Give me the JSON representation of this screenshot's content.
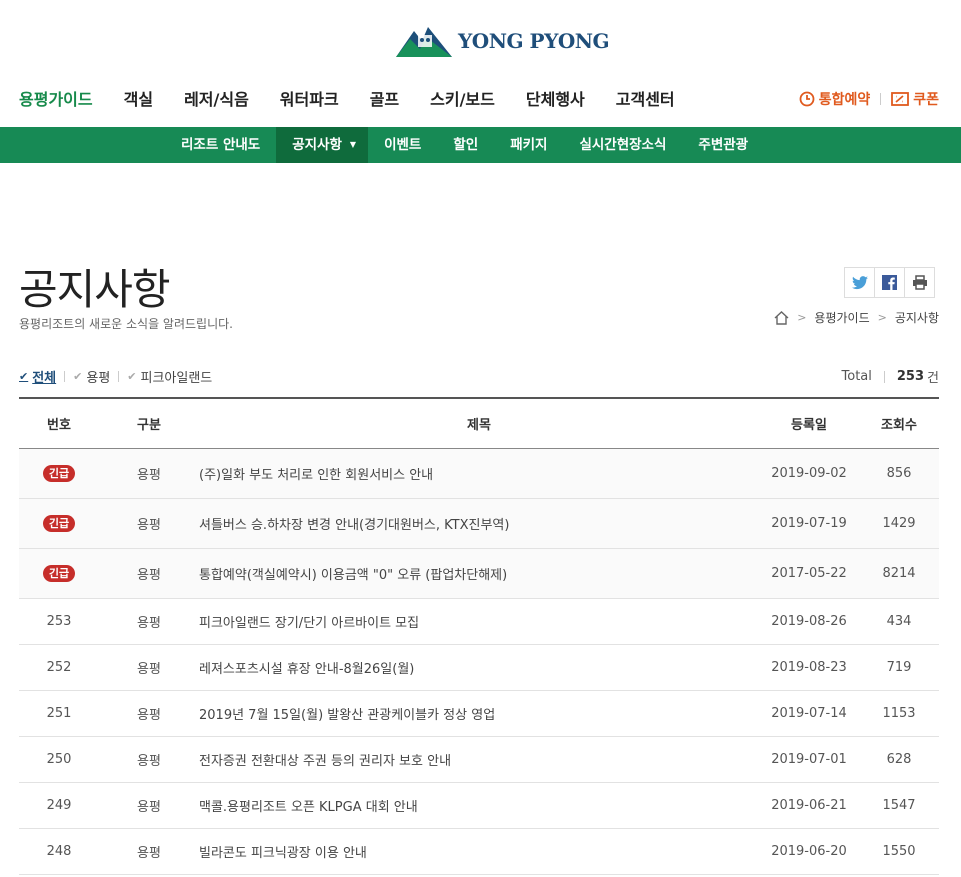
{
  "header": {
    "logo_text": "YONG PYONG",
    "main_nav": [
      "용평가이드",
      "객실",
      "레저/식음",
      "워터파크",
      "골프",
      "스키/보드",
      "단체행사",
      "고객센터"
    ],
    "active_index": 0,
    "util": {
      "reserve": "통합예약",
      "coupon": "쿠폰"
    }
  },
  "sub_nav": {
    "items": [
      "리조트 안내도",
      "공지사항",
      "이벤트",
      "할인",
      "패키지",
      "실시간현장소식",
      "주변관광"
    ],
    "active_index": 1
  },
  "page": {
    "title": "공지사항",
    "description": "용평리조트의 새로운 소식을 알려드립니다.",
    "breadcrumb": [
      "용평가이드",
      "공지사항"
    ]
  },
  "colors": {
    "brand_green": "#178a55",
    "active_green": "#178a4b",
    "urgent_red": "#c62e2a",
    "util_orange": "#e05a1e",
    "navy": "#1f4e7a"
  },
  "filters": {
    "items": [
      "전체",
      "용평",
      "피크아일랜드"
    ],
    "active_index": 0,
    "total_label": "Total",
    "total_count": "253",
    "total_unit": "건"
  },
  "table": {
    "headers": {
      "no": "번호",
      "category": "구분",
      "title": "제목",
      "date": "등록일",
      "views": "조회수"
    },
    "urgent_label": "긴급",
    "rows": [
      {
        "urgent": true,
        "no": "",
        "category": "용평",
        "title": "(주)일화 부도 처리로 인한 회원서비스 안내",
        "date": "2019-09-02",
        "views": "856"
      },
      {
        "urgent": true,
        "no": "",
        "category": "용평",
        "title": "셔틀버스 승.하차장 변경 안내(경기대원버스, KTX진부역)",
        "date": "2019-07-19",
        "views": "1429"
      },
      {
        "urgent": true,
        "no": "",
        "category": "용평",
        "title": "통합예약(객실예약시) 이용금액 \"0\" 오류 (팝업차단해제)",
        "date": "2017-05-22",
        "views": "8214"
      },
      {
        "urgent": false,
        "no": "253",
        "category": "용평",
        "title": "피크아일랜드 장기/단기 아르바이트 모집",
        "date": "2019-08-26",
        "views": "434"
      },
      {
        "urgent": false,
        "no": "252",
        "category": "용평",
        "title": "레져스포츠시설 휴장 안내-8월26일(월)",
        "date": "2019-08-23",
        "views": "719"
      },
      {
        "urgent": false,
        "no": "251",
        "category": "용평",
        "title": "2019년 7월 15일(월) 발왕산 관광케이블카 정상 영업",
        "date": "2019-07-14",
        "views": "1153"
      },
      {
        "urgent": false,
        "no": "250",
        "category": "용평",
        "title": "전자증권 전환대상 주권 등의 권리자 보호 안내",
        "date": "2019-07-01",
        "views": "628"
      },
      {
        "urgent": false,
        "no": "249",
        "category": "용평",
        "title": "맥콜.용평리조트 오픈 KLPGA 대회 안내",
        "date": "2019-06-21",
        "views": "1547"
      },
      {
        "urgent": false,
        "no": "248",
        "category": "용평",
        "title": "빌라콘도 피크닉광장 이용 안내",
        "date": "2019-06-20",
        "views": "1550"
      }
    ]
  }
}
